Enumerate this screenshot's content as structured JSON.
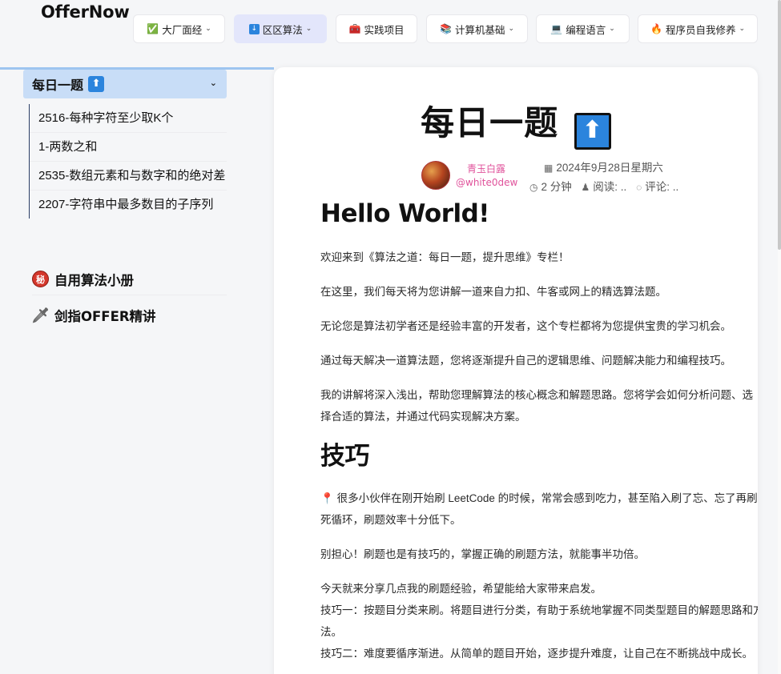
{
  "site": {
    "title": "OfferNow"
  },
  "nav": [
    {
      "icon": "✅",
      "icon_name": "check-box-icon",
      "label": "大厂面经",
      "dropdown": true,
      "active": false
    },
    {
      "icon": "ⓘ",
      "icon_name": "info-box-icon",
      "label": "区区算法",
      "dropdown": true,
      "active": true
    },
    {
      "icon": "🧰",
      "icon_name": "toolbox-icon",
      "label": "实践项目",
      "dropdown": false,
      "active": false
    },
    {
      "icon": "📚",
      "icon_name": "books-icon",
      "label": "计算机基础",
      "dropdown": true,
      "active": false
    },
    {
      "icon": "💻",
      "icon_name": "laptop-icon",
      "label": "编程语言",
      "dropdown": true,
      "active": false
    },
    {
      "icon": "🔥",
      "icon_name": "fire-icon",
      "label": "程序员自我修养",
      "dropdown": true,
      "active": false
    }
  ],
  "sidebar": {
    "active_group": {
      "label": "每日一题",
      "badge": "⬆"
    },
    "sub_items": [
      "2516-每种字符至少取K个",
      "1-两数之和",
      "2535-数组元素和与数字和的绝对差",
      "2207-字符串中最多数目的子序列"
    ],
    "groups": [
      {
        "icon": "秘",
        "icon_name": "secret-icon",
        "label": "自用算法小册"
      },
      {
        "icon": "🗡",
        "icon_name": "dagger-icon",
        "label": "剑指OFFER精讲"
      }
    ]
  },
  "article": {
    "title": "每日一题",
    "title_badge": "⬆",
    "author_name": "青玉白露",
    "author_id": "@white0dew",
    "date": "2024年9月28日星期六",
    "read_time": "2 分钟",
    "views": "阅读: ..",
    "comments": "评论: ..",
    "heading1": "Hello World!",
    "paragraphs1": [
      "欢迎来到《算法之道：每日一题，提升思维》专栏！",
      "在这里，我们每天将为您讲解一道来自力扣、牛客或网上的精选算法题。",
      "无论您是算法初学者还是经验丰富的开发者，这个专栏都将为您提供宝贵的学习机会。",
      "通过每天解决一道算法题，您将逐渐提升自己的逻辑思维、问题解决能力和编程技巧。",
      "我的讲解将深入浅出，帮助您理解算法的核心概念和解题思路。您将学会如何分析问题、选择合适的算法，并通过代码实现解决方案。"
    ],
    "heading2": "技巧",
    "tip_intro": "很多小伙伴在刚开始刷 LeetCode 的时候，常常会感到吃力，甚至陷入刷了忘、忘了再刷的死循环，刷题效率十分低下。",
    "tip_p2": "别担心！刷题也是有技巧的，掌握正确的刷题方法，就能事半功倍。",
    "tip_p3": "今天就来分享几点我的刷题经验，希望能给大家带来启发。",
    "tip_1": "技巧一：按题目分类来刷。将题目进行分类，有助于系统地掌握不同类型题目的解题思路和方法。",
    "tip_2": "技巧二：难度要循序渐进。从简单的题目开始，逐步提升难度，让自己在不断挑战中成长。"
  }
}
